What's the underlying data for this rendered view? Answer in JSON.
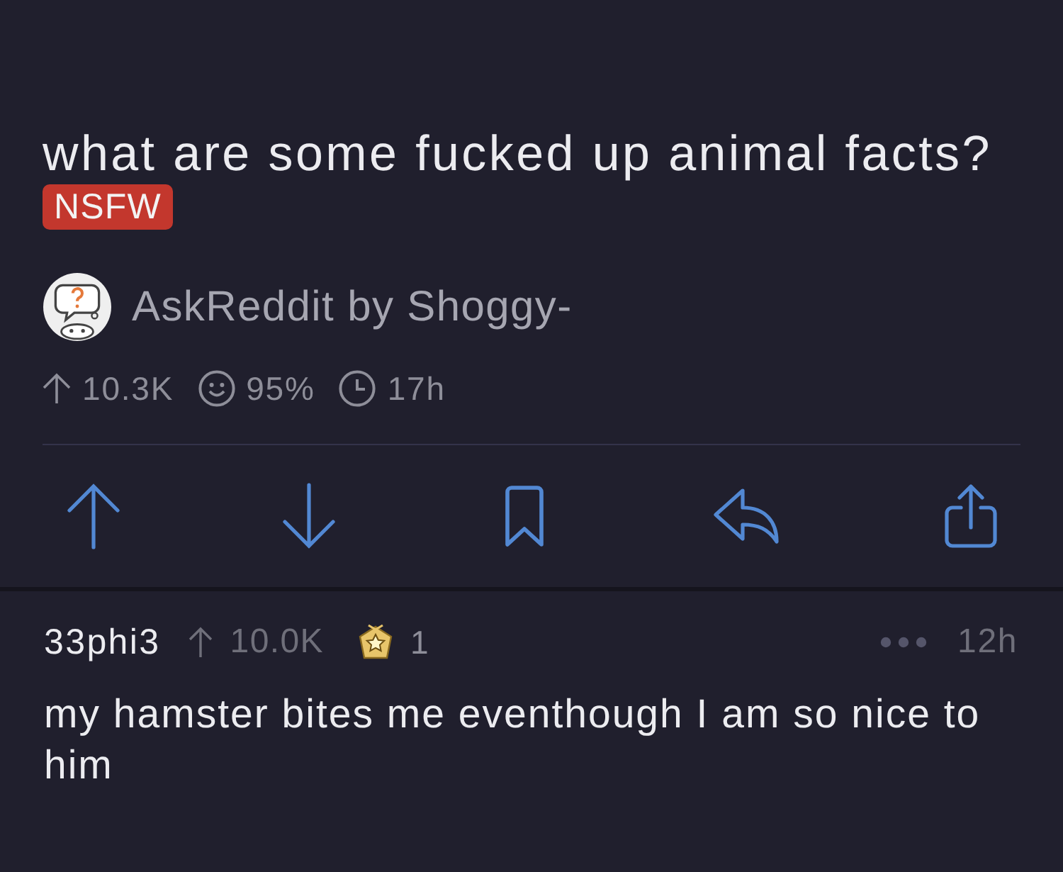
{
  "post": {
    "title": "what are some fucked up animal facts?",
    "flair": "NSFW",
    "byline": "AskReddit by Shoggy-",
    "stats": [
      {
        "kind": "score",
        "text": "10.3K"
      },
      {
        "kind": "ratio",
        "text": "95%"
      },
      {
        "kind": "age",
        "text": "17h"
      }
    ]
  },
  "comment": {
    "author": "33phi3",
    "score": "10.0K",
    "awards": "1",
    "age": "12h",
    "body": "my hamster bites me eventhough I am so nice to him"
  }
}
